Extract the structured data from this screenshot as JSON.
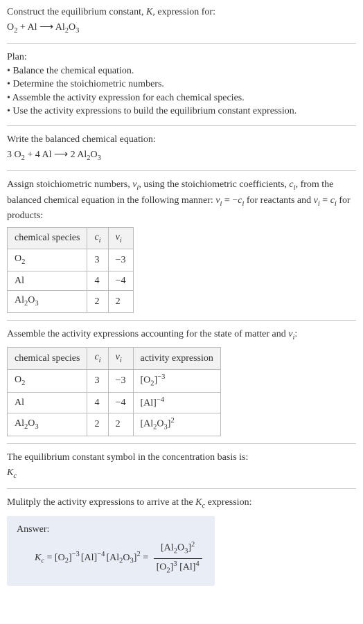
{
  "intro": {
    "line1": "Construct the equilibrium constant, ",
    "k": "K",
    "line1b": ", expression for:",
    "eq_lhs": "O",
    "eq_lhs_sub": "2",
    "eq_plus": " + Al  ⟶  Al",
    "eq_rhs_sub1": "2",
    "eq_rhs_o": "O",
    "eq_rhs_sub2": "3"
  },
  "plan": {
    "title": "Plan:",
    "b1": "• Balance the chemical equation.",
    "b2": "• Determine the stoichiometric numbers.",
    "b3": "• Assemble the activity expression for each chemical species.",
    "b4": "• Use the activity expressions to build the equilibrium constant expression."
  },
  "balanced": {
    "title": "Write the balanced chemical equation:",
    "c1": "3 O",
    "s1": "2",
    "c2": " + 4 Al  ⟶  2 Al",
    "s2": "2",
    "c3": "O",
    "s3": "3"
  },
  "stoich": {
    "intro_a": "Assign stoichiometric numbers, ",
    "nu": "ν",
    "sub_i": "i",
    "intro_b": ", using the stoichiometric coefficients, ",
    "c": "c",
    "intro_c": ", from the balanced chemical equation in the following manner: ",
    "rel1a": "ν",
    "rel1b": " = −",
    "rel1c": "c",
    "intro_d": " for reactants and ",
    "rel2a": "ν",
    "rel2b": " = ",
    "rel2c": "c",
    "intro_e": " for products:",
    "head_species": "chemical species",
    "head_c": "c",
    "head_nu": "ν",
    "rows": [
      {
        "species_a": "O",
        "species_sub": "2",
        "species_b": "",
        "c": "3",
        "nu": "−3"
      },
      {
        "species_a": "Al",
        "species_sub": "",
        "species_b": "",
        "c": "4",
        "nu": "−4"
      },
      {
        "species_a": "Al",
        "species_sub": "2",
        "species_b": "O",
        "species_sub2": "3",
        "c": "2",
        "nu": "2"
      }
    ]
  },
  "activity": {
    "intro_a": "Assemble the activity expressions accounting for the state of matter and ",
    "nu": "ν",
    "sub_i": "i",
    "intro_b": ":",
    "head_species": "chemical species",
    "head_c": "c",
    "head_nu": "ν",
    "head_act": "activity expression",
    "rows": [
      {
        "species_a": "O",
        "species_sub": "2",
        "c": "3",
        "nu": "−3",
        "act_a": "[O",
        "act_sub": "2",
        "act_b": "]",
        "act_sup": "−3"
      },
      {
        "species_a": "Al",
        "species_sub": "",
        "c": "4",
        "nu": "−4",
        "act_a": "[Al]",
        "act_sub": "",
        "act_b": "",
        "act_sup": "−4"
      },
      {
        "species_a": "Al",
        "species_sub": "2",
        "species_b": "O",
        "species_sub2": "3",
        "c": "2",
        "nu": "2",
        "act_a": "[Al",
        "act_sub": "2",
        "act_b": "O",
        "act_sub2": "3",
        "act_c": "]",
        "act_sup": "2"
      }
    ]
  },
  "kc_symbol": {
    "line": "The equilibrium constant symbol in the concentration basis is:",
    "k": "K",
    "sub": "c"
  },
  "multiply": {
    "line_a": "Mulitply the activity expressions to arrive at the ",
    "k": "K",
    "sub": "c",
    "line_b": " expression:"
  },
  "answer": {
    "label": "Answer:",
    "kc_k": "K",
    "kc_sub": "c",
    "eq": " = ",
    "t1": "[O",
    "t1s": "2",
    "t1b": "]",
    "t1sup": "−3",
    "sp": " ",
    "t2": "[Al]",
    "t2sup": "−4",
    "t3": "[Al",
    "t3s": "2",
    "t3b": "O",
    "t3s2": "3",
    "t3c": "]",
    "t3sup": "2",
    "eq2": " = ",
    "num_a": "[Al",
    "num_s1": "2",
    "num_b": "O",
    "num_s2": "3",
    "num_c": "]",
    "num_sup": "2",
    "den_a": "[O",
    "den_s": "2",
    "den_b": "]",
    "den_sup": "3",
    "den_c": " [Al]",
    "den_c_sup": "4"
  }
}
